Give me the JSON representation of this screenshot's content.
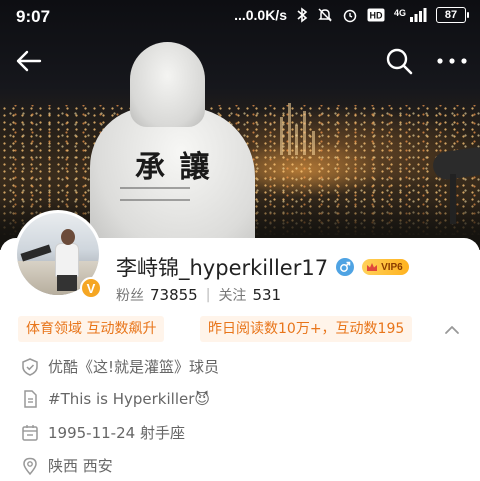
{
  "status_bar": {
    "time": "9:07",
    "network_speed": "...0.0K/s",
    "network_type": "4G",
    "battery": "87",
    "icons": [
      "bluetooth-icon",
      "mute-icon",
      "alarm-icon",
      "hd-icon",
      "signal-icon",
      "battery-icon"
    ]
  },
  "nav": {
    "icons": [
      "back-arrow-icon",
      "search-icon",
      "more-icon"
    ]
  },
  "cover": {
    "hoodie_text": "承 讓"
  },
  "profile": {
    "name": "李峙锦_hyperkiller17",
    "gender_icon": "male-icon",
    "vip_label": "VIP6",
    "verified_badge": "V",
    "fans_label": "粉丝",
    "fans_count": "73855",
    "follow_label": "关注",
    "follow_count": "531"
  },
  "tags": {
    "domain_tag": "体育领域 互动数飙升",
    "stats_tag": "昨日阅读数10万+，互动数195"
  },
  "info": {
    "verified_text": "优酷《这!就是灌篮》球员",
    "bio_text": "#This is Hyperkiller😈",
    "birthday_text": "1995-11-24 射手座",
    "location_text": "陕西 西安"
  },
  "colors": {
    "accent_orange": "#e8751a",
    "tag_bg": "#fff4ea",
    "verified_gold": "#f5a623",
    "gender_blue": "#4fa3e3"
  }
}
